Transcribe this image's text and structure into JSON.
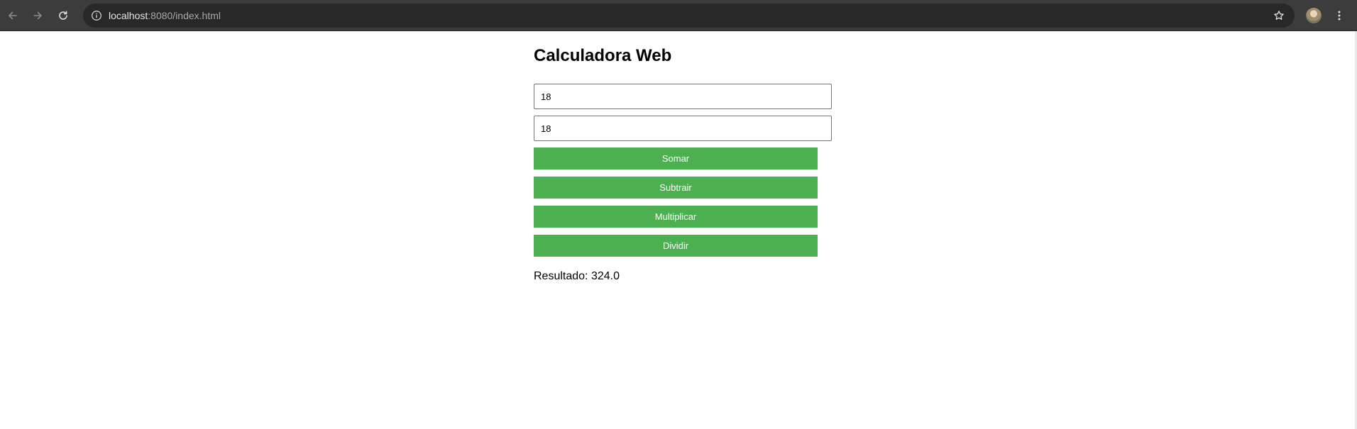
{
  "browser": {
    "url_host": "localhost",
    "url_rest": ":8080/index.html",
    "icons": {
      "back": "arrow-left-icon",
      "forward": "arrow-right-icon",
      "reload": "reload-icon",
      "site_info": "info-icon",
      "bookmark": "star-icon",
      "menu": "kebab-menu-icon"
    }
  },
  "app": {
    "title": "Calculadora Web",
    "input1_value": "18",
    "input2_value": "18",
    "buttons": {
      "add": "Somar",
      "subtract": "Subtrair",
      "multiply": "Multiplicar",
      "divide": "Dividir"
    },
    "result_text": "Resultado: 324.0"
  },
  "colors": {
    "button_bg": "#4caf50",
    "button_text": "#ffffff",
    "toolbar_bg": "#3c3c3c",
    "omnibox_bg": "#282828"
  }
}
